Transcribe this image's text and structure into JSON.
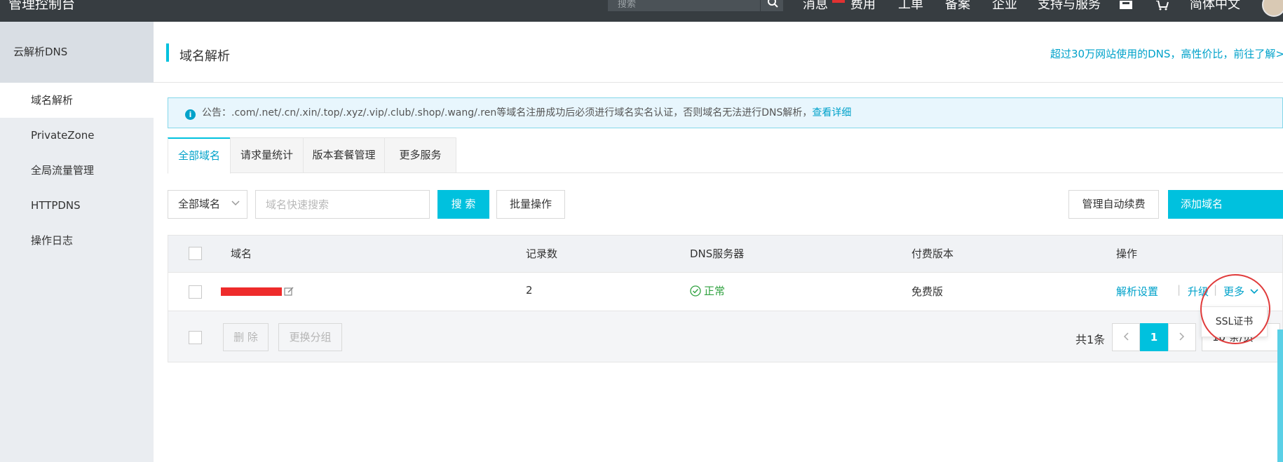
{
  "topbar": {
    "brand": "管理控制台",
    "search_placeholder": "搜索",
    "nav": [
      "消息",
      "费用",
      "工单",
      "备案",
      "企业",
      "支持与服务",
      "简体中文"
    ]
  },
  "sidebar": {
    "head": "云解析DNS",
    "items": [
      {
        "label": "域名解析",
        "active": true
      },
      {
        "label": "PrivateZone"
      },
      {
        "label": "全局流量管理"
      },
      {
        "label": "HTTPDNS"
      },
      {
        "label": "操作日志"
      }
    ]
  },
  "page": {
    "title": "域名解析",
    "promo": "超过30万网站使用的DNS，高性价比，前往了解>>"
  },
  "notice": {
    "text": "公告：.com/.net/.cn/.xin/.top/.xyz/.vip/.club/.shop/.wang/.ren等域名注册成功后必须进行域名实名认证，否则域名无法进行DNS解析，",
    "link": "查看详细"
  },
  "tabs": [
    "全部域名",
    "请求量统计",
    "版本套餐管理",
    "更多服务"
  ],
  "toolbar": {
    "filter": "全部域名",
    "search_placeholder": "域名快速搜索",
    "search_button": "搜 索",
    "batch_button": "批量操作",
    "auto_renew_button": "管理自动续费",
    "add_button": "添加域名"
  },
  "table": {
    "headers": [
      "域名",
      "记录数",
      "DNS服务器",
      "付费版本",
      "操作"
    ],
    "rows": [
      {
        "records": "2",
        "dns_status": "正常",
        "plan": "免费版",
        "actions": {
          "settings": "解析设置",
          "upgrade": "升级",
          "more": "更多"
        }
      }
    ],
    "footer": {
      "delete": "删 除",
      "change_group": "更换分组",
      "total": "共1条",
      "current_page": "1",
      "page_size": "10 条/页"
    }
  },
  "popup": {
    "item": "SSL证书"
  },
  "colors": {
    "accent": "#00c1de",
    "link": "#00a2ca",
    "ok": "#30a240",
    "annotation": "#e03b3b"
  }
}
